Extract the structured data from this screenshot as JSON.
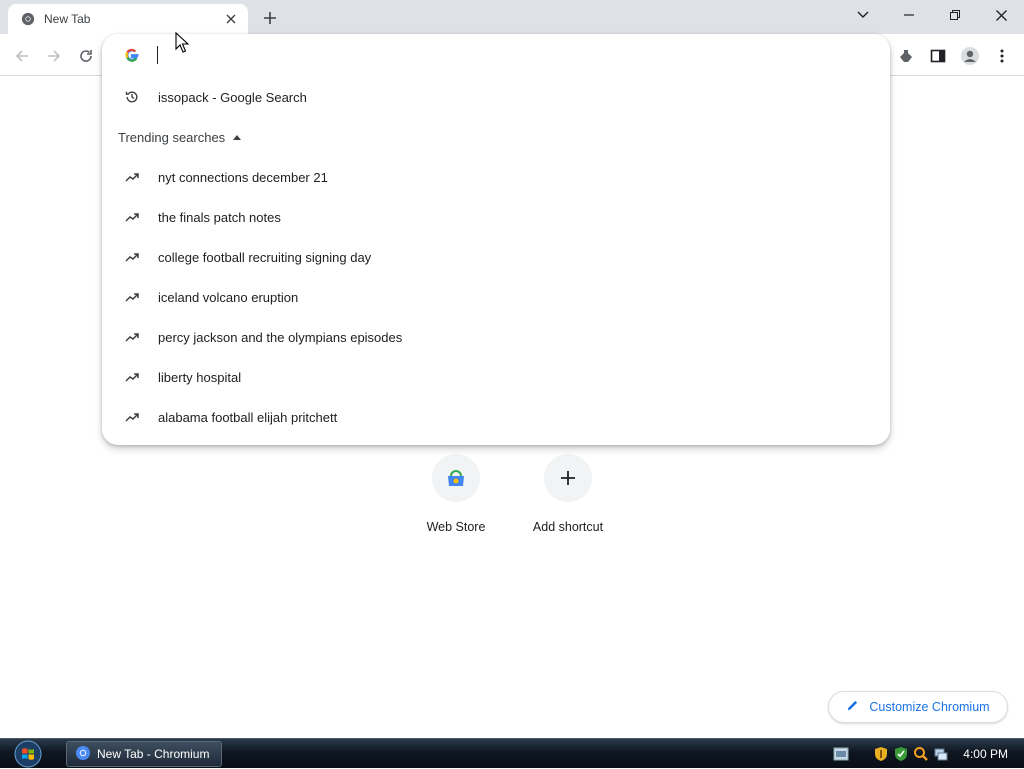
{
  "window": {
    "tab_title": "New Tab",
    "controls": {
      "minimize": "–",
      "restore": "❐",
      "close": "✕",
      "tab_search": "⌄"
    }
  },
  "omnibox": {
    "value": "",
    "placeholder": "",
    "history_suggestion": "issopack - Google Search",
    "trending_header": "Trending searches",
    "trending": [
      "nyt connections december 21",
      "the finals patch notes",
      "college football recruiting signing day",
      "iceland volcano eruption",
      "percy jackson and the olympians episodes",
      "liberty hospital",
      "alabama football elijah pritchett"
    ]
  },
  "shortcuts": [
    {
      "label": "Web Store",
      "icon": "webstore-icon"
    },
    {
      "label": "Add shortcut",
      "icon": "plus-icon"
    }
  ],
  "customize_label": "Customize Chromium",
  "taskbar": {
    "task_label": "New Tab - Chromium",
    "clock": "4:00 PM"
  },
  "colors": {
    "accent": "#1a73e8",
    "tabstrip": "#dee1e6",
    "taskbar": "#0e1620"
  }
}
